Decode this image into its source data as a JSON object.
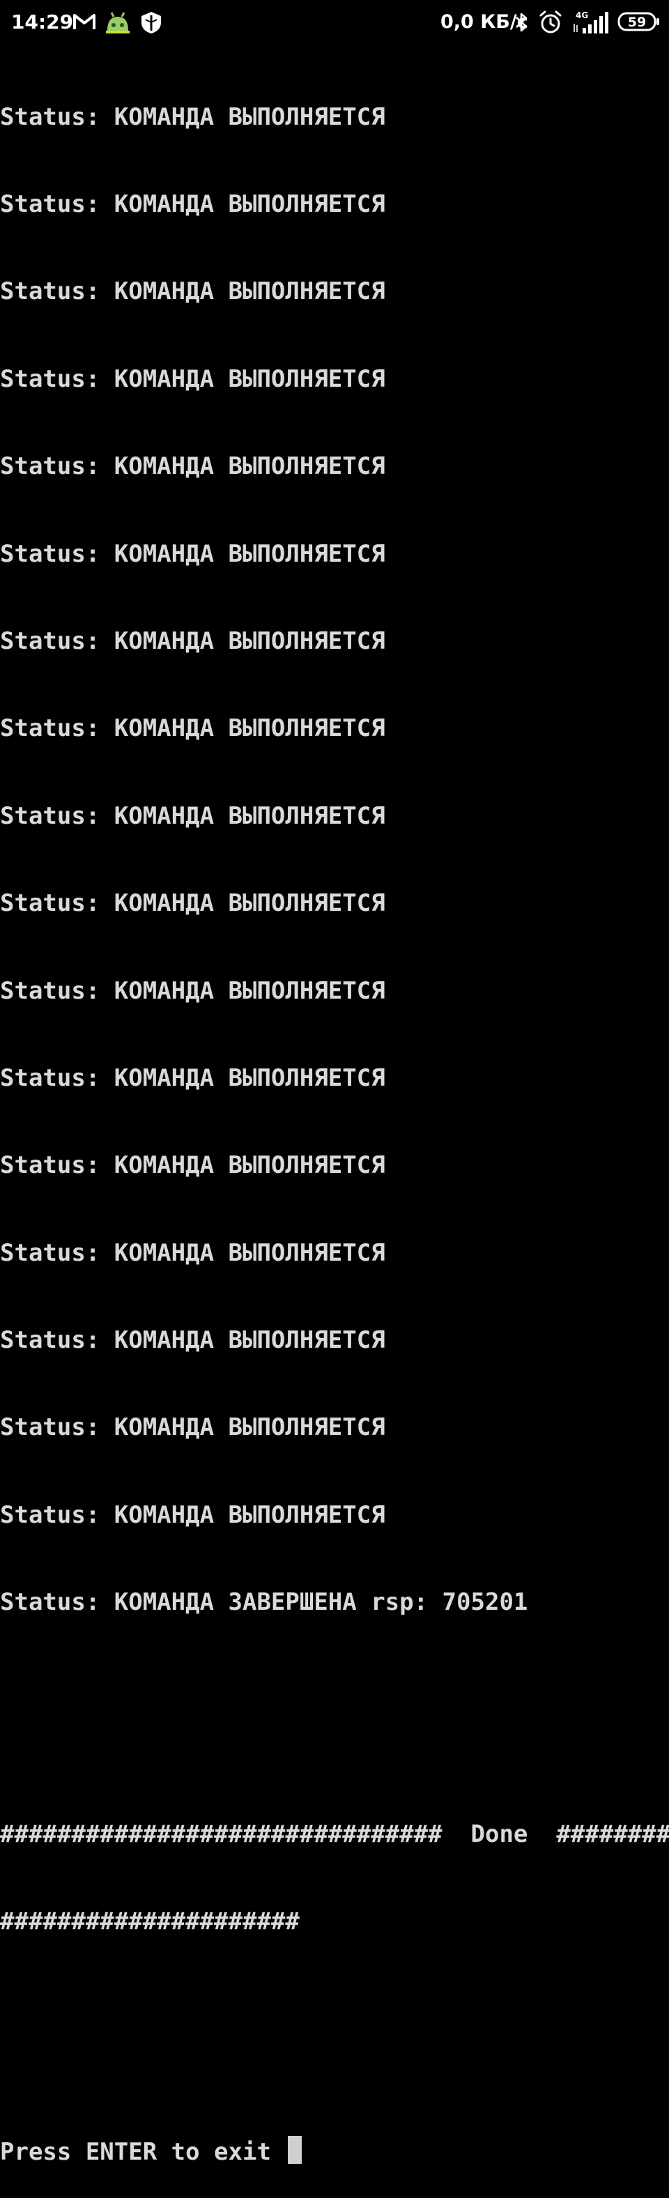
{
  "statusbar": {
    "time": "14:29",
    "speed": "0,0 КБ/с",
    "network": "4G",
    "battery": "59",
    "icons": [
      "gmail-icon",
      "android-bot-icon",
      "shield-app-icon",
      "bluetooth-icon",
      "alarm-icon",
      "signal-icon",
      "battery-icon"
    ]
  },
  "terminal": {
    "status_lines": [
      "Status: КОМАНДА ВЫПОЛНЯЕТСЯ",
      "Status: КОМАНДА ВЫПОЛНЯЕТСЯ",
      "Status: КОМАНДА ВЫПОЛНЯЕТСЯ",
      "Status: КОМАНДА ВЫПОЛНЯЕТСЯ",
      "Status: КОМАНДА ВЫПОЛНЯЕТСЯ",
      "Status: КОМАНДА ВЫПОЛНЯЕТСЯ",
      "Status: КОМАНДА ВЫПОЛНЯЕТСЯ",
      "Status: КОМАНДА ВЫПОЛНЯЕТСЯ",
      "Status: КОМАНДА ВЫПОЛНЯЕТСЯ",
      "Status: КОМАНДА ВЫПОЛНЯЕТСЯ",
      "Status: КОМАНДА ВЫПОЛНЯЕТСЯ",
      "Status: КОМАНДА ВЫПОЛНЯЕТСЯ",
      "Status: КОМАНДА ВЫПОЛНЯЕТСЯ",
      "Status: КОМАНДА ВЫПОЛНЯЕТСЯ",
      "Status: КОМАНДА ВЫПОЛНЯЕТСЯ",
      "Status: КОМАНДА ВЫПОЛНЯЕТСЯ",
      "Status: КОМАНДА ВЫПОЛНЯЕТСЯ",
      "Status: КОМАНДА ЗАВЕРШЕНА rsp: 705201"
    ],
    "done_line_1": "###############################  Done  ##########",
    "done_line_2": "#####################",
    "prompt": "Press ENTER to exit "
  },
  "colors": {
    "background": "#000000",
    "text": "#d9d9d9",
    "cursor": "#d0d0d0"
  }
}
